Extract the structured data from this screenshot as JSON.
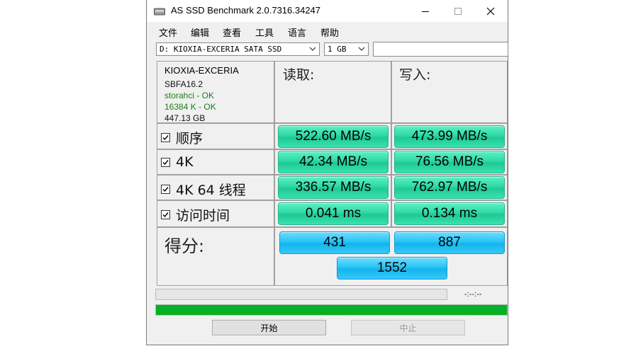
{
  "window": {
    "title": "AS SSD Benchmark 2.0.7316.34247",
    "minimize_glyph": "—",
    "maximize_glyph": "☐",
    "close_glyph": "✕"
  },
  "menu": [
    "文件",
    "编辑",
    "查看",
    "工具",
    "语言",
    "帮助"
  ],
  "toolbar": {
    "drive_select": "D: KIOXIA-EXCERIA SATA SSD",
    "size_select": "1 GB",
    "extra_input": ""
  },
  "drive_info": {
    "name": "KIOXIA-EXCERIA",
    "firmware": "SBFA16.2",
    "driver_status": "storahci - OK",
    "alignment_status": "16384 K - OK",
    "capacity": "447.13 GB"
  },
  "columns": {
    "read": "读取:",
    "write": "写入:"
  },
  "rows": [
    {
      "label": "顺序",
      "read": "522.60 MB/s",
      "write": "473.99 MB/s"
    },
    {
      "label": "4K",
      "read": "42.34 MB/s",
      "write": "76.56 MB/s"
    },
    {
      "label": "4K 64 线程",
      "read": "336.57 MB/s",
      "write": "762.97 MB/s"
    },
    {
      "label": "访问时间",
      "read": "0.041 ms",
      "write": "0.134 ms"
    }
  ],
  "score": {
    "label": "得分:",
    "read": "431",
    "write": "887",
    "total": "1552"
  },
  "progress": {
    "time_text": "-:--:--",
    "top_fraction": 0,
    "bottom_fraction": 1.0
  },
  "buttons": {
    "start": "开始",
    "stop": "中止"
  },
  "colors": {
    "result_green": "#2ed9a4",
    "score_blue": "#29c4f6",
    "progress_green": "#06b025",
    "status_ok_green": "#1a7f1a"
  }
}
